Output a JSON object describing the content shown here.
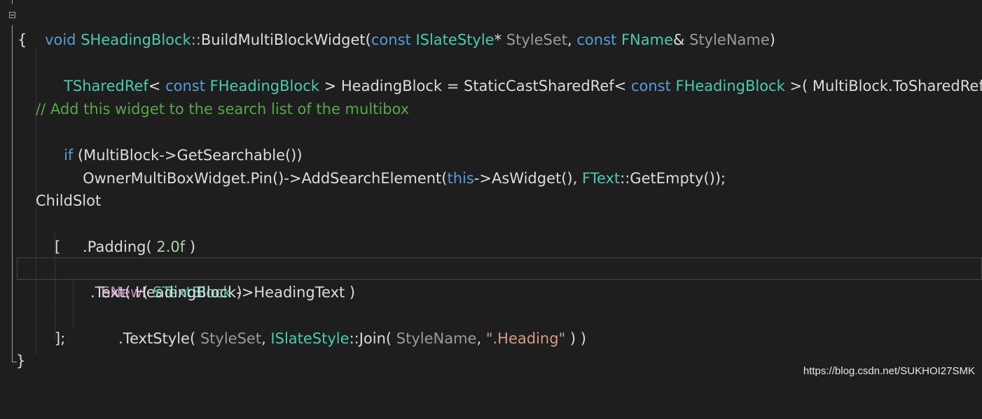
{
  "colors": {
    "background": "#1e1e1e",
    "keyword": "#569cd6",
    "type": "#4ec9b0",
    "parameter": "#9a9a9a",
    "default_text": "#dcdcdc",
    "macro": "#c586c0",
    "number": "#b5cea8",
    "string": "#d69d85",
    "comment": "#57a64a"
  },
  "icons": {
    "collapse": "minus-box-icon"
  },
  "code": {
    "line1": {
      "kw_void": "void",
      "class": "SHeadingBlock",
      "scope": "::",
      "method": "BuildMultiBlockWidget(",
      "kw_const1": "const",
      "type1": "ISlateStyle",
      "ptr": "*",
      "param1": "StyleSet",
      "comma": ", ",
      "kw_const2": "const",
      "type2": "FName",
      "ref": "&",
      "param2": "StyleName",
      "close": ")"
    },
    "line2": {
      "brace": "{"
    },
    "line3": {
      "type1": "TSharedRef",
      "lt1": "< ",
      "kw_const1": "const",
      "type2": "FHeadingBlock",
      "mid": " > HeadingBlock = StaticCastSharedRef< ",
      "kw_const2": "const",
      "type3": "FHeadingBlock",
      "tail": " >( MultiBlock.ToSharedRef() );"
    },
    "line4": {
      "comment": "// Add this widget to the search list of the multibox"
    },
    "line5": {
      "kw_if": "if",
      "rest": " (MultiBlock->GetSearchable())"
    },
    "line6": {
      "head": "OwnerMultiBoxWidget.Pin()->AddSearchElement(",
      "kw_this": "this",
      "mid": "->AsWidget(), ",
      "type": "FText",
      "tail": "::GetEmpty());"
    },
    "line7": {
      "text": "ChildSlot"
    },
    "line8": {
      "head": ".Padding( ",
      "num": "2.0f",
      "tail": " )"
    },
    "line9": {
      "bracket": "["
    },
    "line10": {
      "macro": "SNew",
      "open": "( ",
      "type": "STextBlock",
      "close": " )"
    },
    "line11": {
      "text": ".Text( HeadingBlock->HeadingText )"
    },
    "line12": {
      "head": ".TextStyle( ",
      "param1": "StyleSet",
      "comma1": ", ",
      "type": "ISlateStyle",
      "join": "::Join( ",
      "param2": "StyleName",
      "comma2": ", ",
      "str": "\".Heading\"",
      "tail": " ) )"
    },
    "line13": {
      "text": "];"
    },
    "line14": {
      "brace": "}"
    }
  },
  "watermark": "https://blog.csdn.net/SUKHOI27SMK"
}
